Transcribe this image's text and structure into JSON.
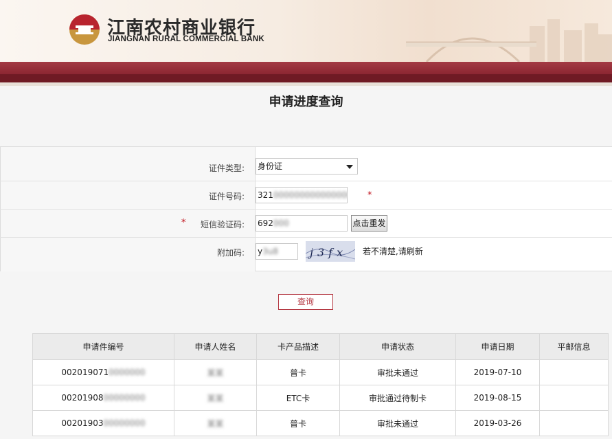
{
  "brand": {
    "name_cn": "江南农村商业银行",
    "name_en": "JIANGNAN RURAL COMMERCIAL BANK",
    "colors": {
      "primary": "#8c2632",
      "accent": "#b53a44",
      "logo_gold": "#c8963e"
    }
  },
  "page_title": "申请进度查询",
  "form": {
    "id_type": {
      "label": "证件类型:",
      "value": "身份证"
    },
    "id_number": {
      "label": "证件号码:",
      "value_visible": "321",
      "value_masked": "0000000000000000",
      "required_mark": "*"
    },
    "sms_code": {
      "label": "短信验证码:",
      "value_visible": "692",
      "value_masked": "000",
      "required_mark": "*",
      "resend_label": "点击重发"
    },
    "captcha": {
      "label": "附加码:",
      "value_visible": "y",
      "value_masked": "3u8",
      "image_text": "j3fx",
      "hint": "若不清楚,请刷新"
    }
  },
  "query_button": "查询",
  "results": {
    "headers": [
      "申请件编号",
      "申请人姓名",
      "卡产品描述",
      "申请状态",
      "申请日期",
      "平邮信息"
    ],
    "rows": [
      {
        "id_visible": "002019071",
        "id_masked": "0000000",
        "name_masked": "某某",
        "product": "普卡",
        "status": "审批未通过",
        "date": "2019-07-10",
        "mail": ""
      },
      {
        "id_visible": "00201908",
        "id_masked": "00000000",
        "name_masked": "某某",
        "product": "ETC卡",
        "status": "审批通过待制卡",
        "date": "2019-08-15",
        "mail": ""
      },
      {
        "id_visible": "00201903",
        "id_masked": "00000000",
        "name_masked": "某某",
        "product": "普卡",
        "status": "审批未通过",
        "date": "2019-03-26",
        "mail": ""
      }
    ]
  }
}
